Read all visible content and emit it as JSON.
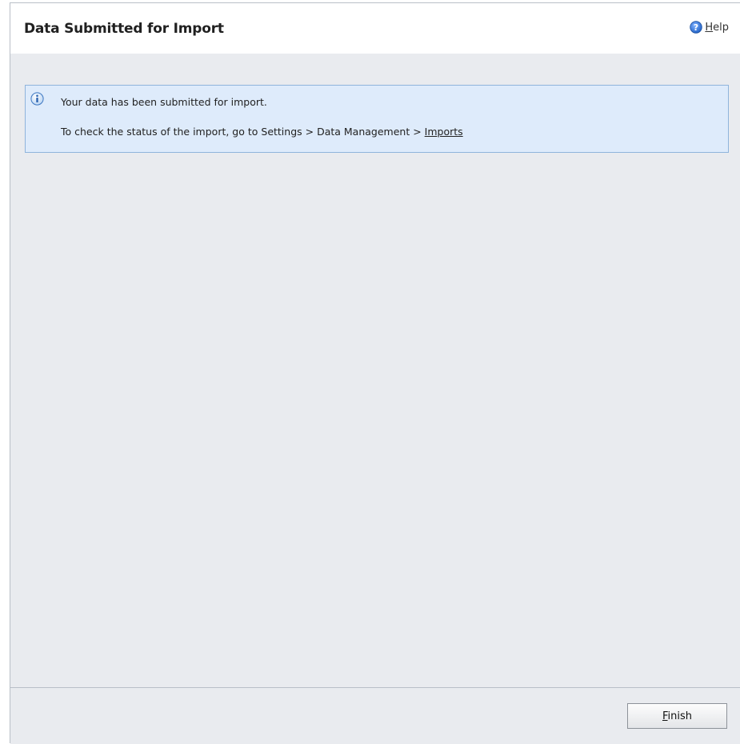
{
  "header": {
    "title": "Data Submitted for Import",
    "help": {
      "mnemonic": "H",
      "rest": "elp",
      "icon": "help-icon"
    }
  },
  "notice": {
    "icon": "info-icon",
    "line1": "Your data has been submitted for import.",
    "line2_prefix": "To check the status of the import, go to Settings > Data Management > ",
    "line2_link": "Imports"
  },
  "footer": {
    "finish_button": {
      "mnemonic": "F",
      "rest": "inish"
    }
  },
  "colors": {
    "content_background": "#e9ebef",
    "notice_background": "#deebfb",
    "notice_border": "#8fb4dc",
    "help_icon": "#2f6fcf"
  }
}
